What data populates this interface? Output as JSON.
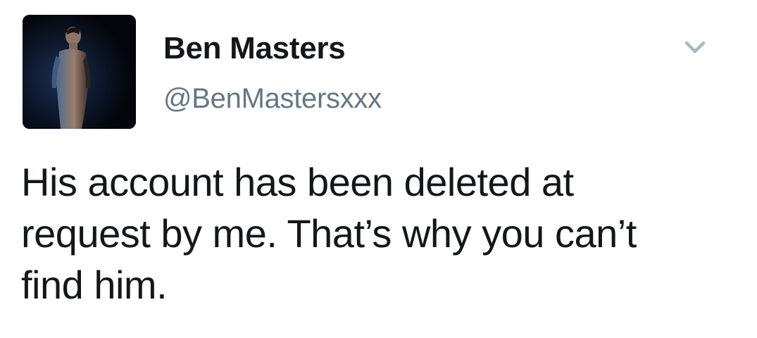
{
  "tweet": {
    "author": {
      "display_name": "Ben Masters",
      "handle": "@BenMastersxxx",
      "avatar_icon": "profile-photo"
    },
    "menu_icon": "chevron-down-icon",
    "text_lines": [
      "His account has been deleted at",
      "request by me. That’s why you can’t",
      "find him."
    ]
  }
}
